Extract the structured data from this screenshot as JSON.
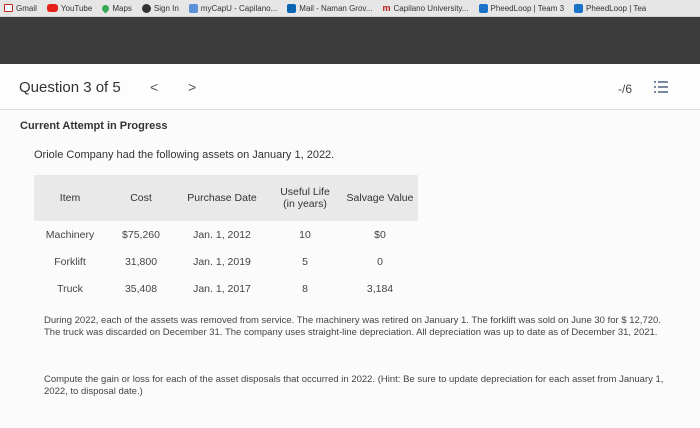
{
  "bookmarks": [
    {
      "label": "Gmail",
      "icon": "gmail-icon"
    },
    {
      "label": "YouTube",
      "icon": "youtube-icon"
    },
    {
      "label": "Maps",
      "icon": "maps-icon"
    },
    {
      "label": "Sign In",
      "icon": "sign-in-icon"
    },
    {
      "label": "myCapU - Capilano...",
      "icon": "capilano-icon"
    },
    {
      "label": "Mail - Naman Grov...",
      "icon": "mail-icon"
    },
    {
      "label": "Capilano University...",
      "icon": "university-icon"
    },
    {
      "label": "PheedLoop | Team 3",
      "icon": "pheedloop-icon"
    },
    {
      "label": "PheedLoop | Tea",
      "icon": "pheedloop-icon"
    }
  ],
  "question": {
    "title": "Question 3 of 5",
    "prev": "<",
    "next": ">",
    "score": "-/6"
  },
  "status": "Current Attempt in Progress",
  "intro": "Oriole Company had the following assets on January 1, 2022.",
  "table": {
    "headers": [
      "Item",
      "Cost",
      "Purchase Date",
      "Useful Life\n(in years)",
      "Salvage Value"
    ],
    "rows": [
      [
        "Machinery",
        "$75,260",
        "Jan. 1, 2012",
        "10",
        "$0"
      ],
      [
        "Forklift",
        "31,800",
        "Jan. 1, 2019",
        "5",
        "0"
      ],
      [
        "Truck",
        "35,408",
        "Jan. 1, 2017",
        "8",
        "3,184"
      ]
    ]
  },
  "paragraph1": "During 2022, each of the assets was removed from service. The machinery was retired on January 1. The forklift was sold on June 30 for $ 12,720. The truck was discarded on December 31. The company uses straight-line depreciation. All depreciation was up to date as of December 31, 2021.",
  "paragraph2": "Compute the gain or loss for each of the asset disposals that occurred in 2022. (Hint: Be sure to update depreciation for each asset from January 1, 2022, to disposal date.)"
}
